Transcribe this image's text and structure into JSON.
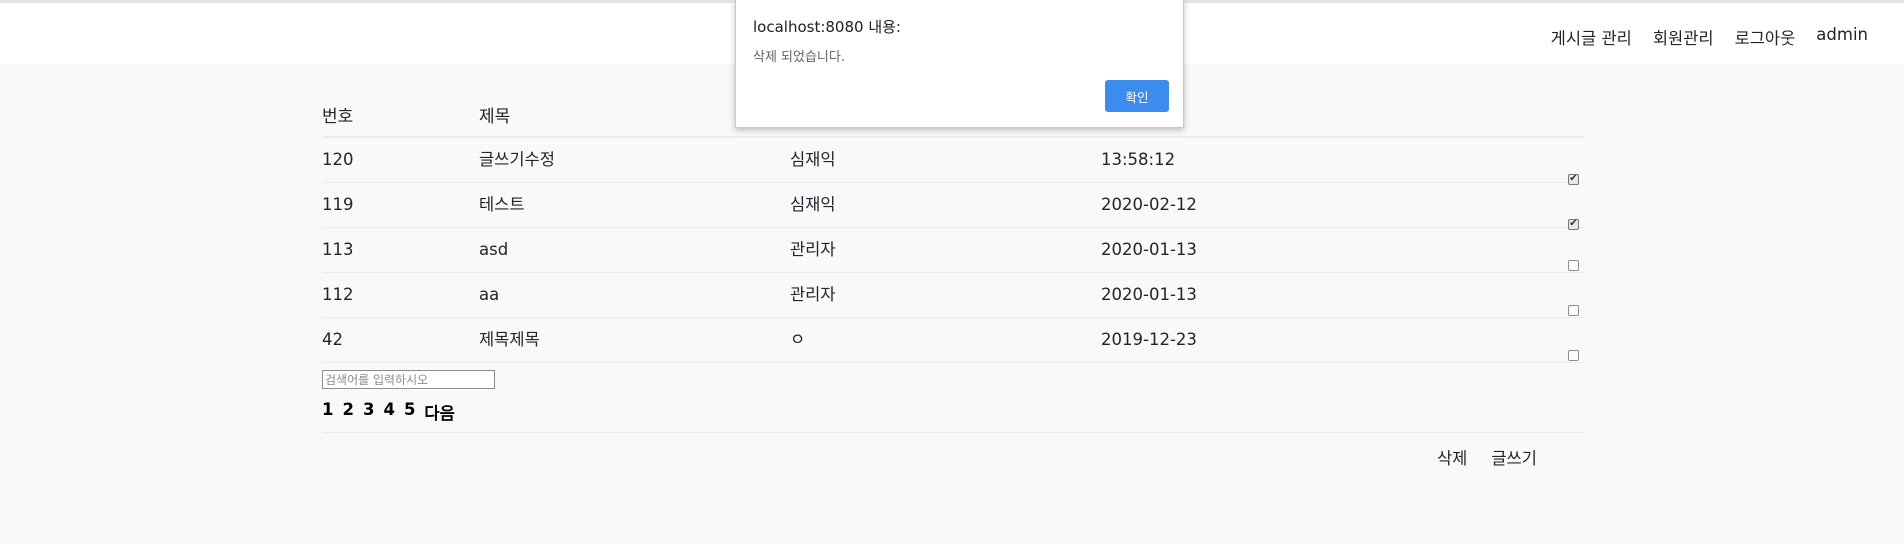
{
  "nav": {
    "items": [
      "게시글 관리",
      "회원관리",
      "로그아웃",
      "admin"
    ]
  },
  "table": {
    "headers": {
      "num": "번호",
      "title": "제목"
    },
    "rows": [
      {
        "num": "120",
        "title": "글쓰기수정",
        "writer": "심재익",
        "date": "13:58:12",
        "checked": true
      },
      {
        "num": "119",
        "title": "테스트",
        "writer": "심재익",
        "date": "2020-02-12",
        "checked": true
      },
      {
        "num": "113",
        "title": "asd",
        "writer": "관리자",
        "date": "2020-01-13",
        "checked": false
      },
      {
        "num": "112",
        "title": "aa",
        "writer": "관리자",
        "date": "2020-01-13",
        "checked": false
      },
      {
        "num": "42",
        "title": "제목제목",
        "writer": "ㅇ",
        "date": "2019-12-23",
        "checked": false
      }
    ]
  },
  "search": {
    "placeholder": "검색어를 입력하시오",
    "value": ""
  },
  "pager": {
    "pages": [
      "1",
      "2",
      "3",
      "4",
      "5"
    ],
    "next": "다음"
  },
  "actions": {
    "delete": "삭제",
    "write": "글쓰기"
  },
  "dialog": {
    "title": "localhost:8080 내용:",
    "message": "삭제 되었습니다.",
    "ok": "확인"
  },
  "colors": {
    "accent": "#3b8ced",
    "background": "#f8f9fa"
  }
}
